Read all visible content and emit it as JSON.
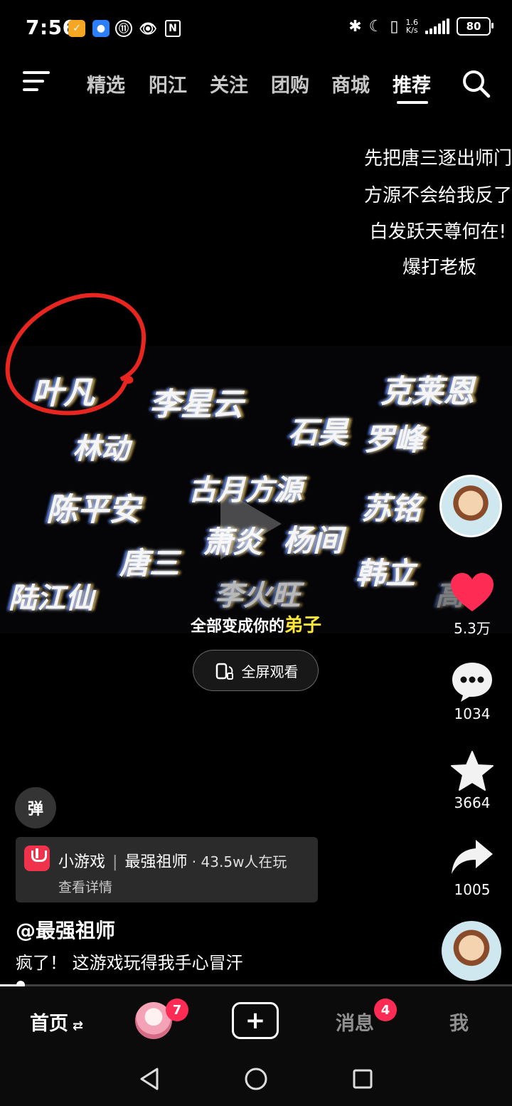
{
  "status_bar": {
    "time": "7:56",
    "net_speed_value": "1.6",
    "net_speed_unit": "K/s",
    "battery": "80"
  },
  "top_nav": {
    "tabs": [
      "精选",
      "阳江",
      "关注",
      "团购",
      "商城",
      "推荐"
    ],
    "active_tab": "推荐"
  },
  "captions": [
    "先把唐三逐出师门",
    "方源不会给我反了",
    "白发跃天尊何在!",
    "爆打老板"
  ],
  "video": {
    "names": [
      "叶凡",
      "李星云",
      "克莱恩",
      "石昊",
      "罗峰",
      "林动",
      "陈平安",
      "古月方源",
      "苏铭",
      "萧炎",
      "杨间",
      "唐三",
      "韩立",
      "陆江仙",
      "李火旺",
      "高"
    ],
    "subtitle_prefix": "全部变成你的",
    "subtitle_highlight": "弟子"
  },
  "fullscreen_button": "全屏观看",
  "rail": {
    "likes": "5.3万",
    "comments": "1034",
    "favorites": "3664",
    "shares": "1005"
  },
  "danmaku_button": "弹",
  "game_card": {
    "type": "小游戏",
    "name": "最强祖师",
    "players": "43.5w人在玩",
    "detail": "查看详情"
  },
  "author": "@最强祖师",
  "description": "疯了！ 这游戏玩得我手心冒汗",
  "progress": 0.04,
  "tab_bar": {
    "home": "首页",
    "friends_badge": "7",
    "messages": "消息",
    "messages_badge": "4",
    "me": "我"
  },
  "colors": {
    "accent": "#fe2c55",
    "like": "#fe2c55",
    "highlight": "#ffe83a",
    "annotation_circle": "#e8261f"
  }
}
